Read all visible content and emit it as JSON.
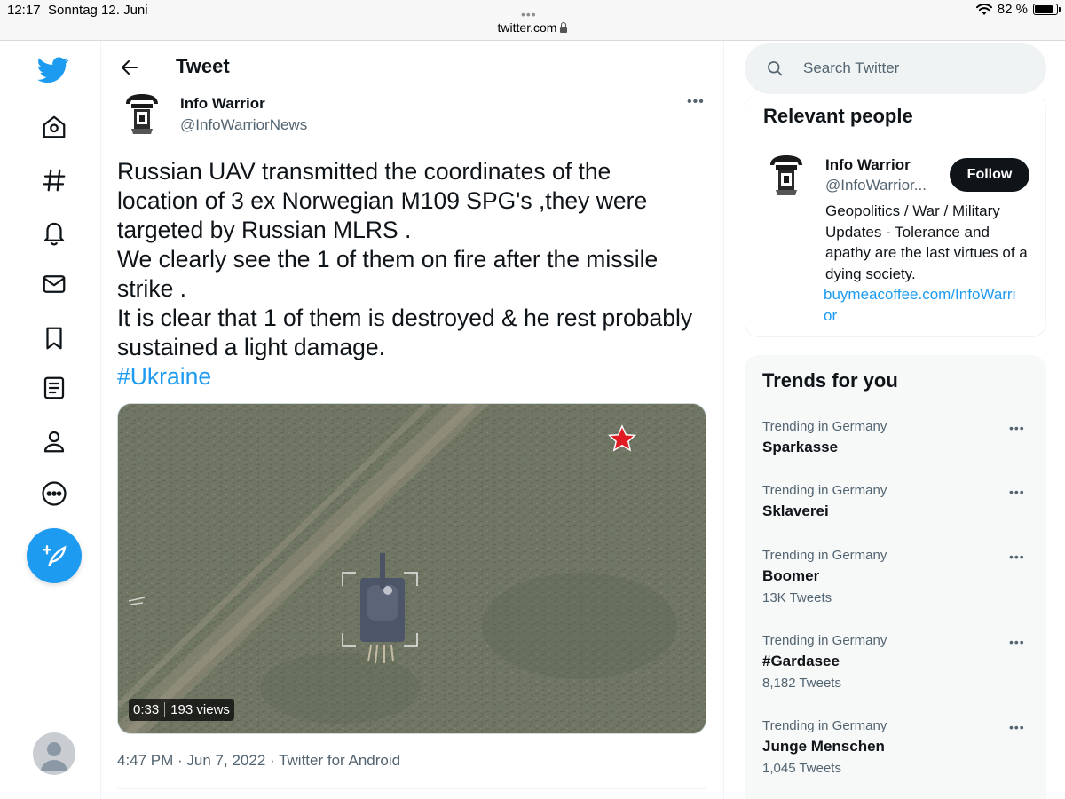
{
  "status_bar": {
    "time": "12:17",
    "date": "Sonntag 12. Juni",
    "url": "twitter.com",
    "battery": "82 %",
    "battery_level": 0.82
  },
  "nav": {
    "items": [
      "home",
      "explore",
      "notifications",
      "messages",
      "bookmarks",
      "lists",
      "profile",
      "more"
    ]
  },
  "header": {
    "title": "Tweet"
  },
  "tweet": {
    "author_name": "Info Warrior",
    "author_handle": "@InfoWarriorNews",
    "text_lines": [
      "Russian UAV transmitted the coordinates of the",
      "location of 3 ex Norwegian M109 SPG's ,they were",
      "targeted by Russian MLRS .",
      "We clearly see the 1 of them on fire after the missile",
      "strike .",
      "It is clear that 1 of them is destroyed & he rest probably",
      "sustained a light damage."
    ],
    "hashtag": "#Ukraine",
    "video": {
      "duration": "0:33",
      "views": "193 views"
    },
    "meta": "4:47 PM · Jun 7, 2022 · Twitter for Android"
  },
  "search": {
    "placeholder": "Search Twitter"
  },
  "relevant_people": {
    "title": "Relevant people",
    "name": "Info Warrior",
    "handle": "@InfoWarrior...",
    "follow_label": "Follow",
    "bio": "Geopolitics / War / Military Updates - Tolerance and apathy are the last virtues of a dying society.",
    "link_lines": [
      "buymeacoffee.com/InfoWarri",
      "or"
    ]
  },
  "trends": {
    "title": "Trends for you",
    "items": [
      {
        "context": "Trending in Germany",
        "name": "Sparkasse",
        "count": ""
      },
      {
        "context": "Trending in Germany",
        "name": "Sklaverei",
        "count": ""
      },
      {
        "context": "Trending in Germany",
        "name": "Boomer",
        "count": "13K Tweets"
      },
      {
        "context": "Trending in Germany",
        "name": "#Gardasee",
        "count": "8,182 Tweets"
      },
      {
        "context": "Trending in Germany",
        "name": "Junge Menschen",
        "count": "1,045 Tweets"
      }
    ]
  },
  "colors": {
    "accent": "#1d9bf0",
    "text": "#0f1419",
    "secondary": "#536471"
  }
}
